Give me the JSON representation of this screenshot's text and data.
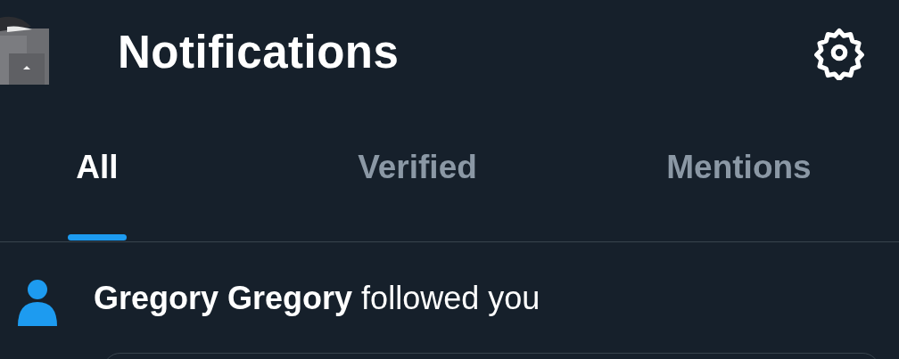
{
  "header": {
    "title": "Notifications"
  },
  "tabs": [
    {
      "label": "All",
      "selected": true
    },
    {
      "label": "Verified",
      "selected": false
    },
    {
      "label": "Mentions",
      "selected": false
    }
  ],
  "notifications": [
    {
      "name": "Gregory Gregory",
      "action": "followed you"
    }
  ]
}
